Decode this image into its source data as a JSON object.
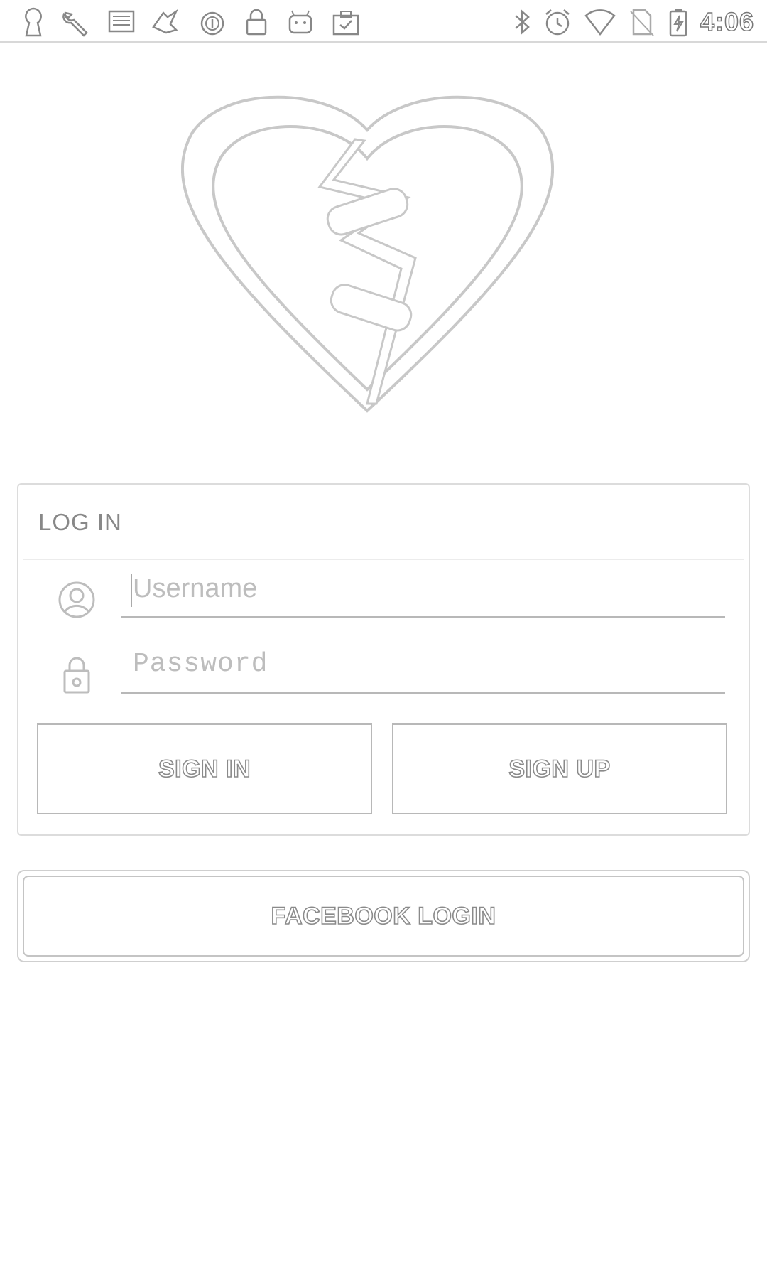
{
  "status_bar": {
    "time": "4:06",
    "left_icons": [
      "keyhole-icon",
      "wrench-icon",
      "news-icon",
      "game-icon",
      "circle-icon",
      "lock-icon",
      "android-icon",
      "clipboard-check-icon"
    ],
    "right_icons": [
      "bluetooth-icon",
      "alarm-icon",
      "wifi-icon",
      "no-sim-icon",
      "battery-charging-icon"
    ]
  },
  "logo": {
    "icon": "broken-heart-logo"
  },
  "login": {
    "title": "LOG IN",
    "username": {
      "placeholder": "Username",
      "value": ""
    },
    "password": {
      "placeholder": "Password",
      "value": ""
    },
    "sign_in_label": "SIGN IN",
    "sign_up_label": "SIGN UP"
  },
  "facebook": {
    "label": "FACEBOOK LOGIN"
  }
}
